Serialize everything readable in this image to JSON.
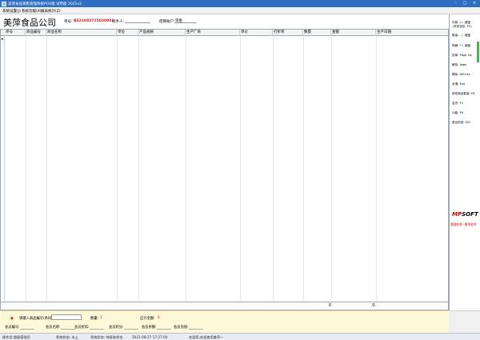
{
  "window": {
    "title": "美萍食品销售管理系统POS版 试用版 2021v2",
    "minimize_glyph": "–",
    "maximize_glyph": "□",
    "close_glyph": "×"
  },
  "menu": [
    "系统设置(J)",
    "系统功能(X)",
    "报表统计(Z)"
  ],
  "header": {
    "company": "美萍食品公司",
    "order_no_label": "单号:",
    "order_no": "BS21082715030001",
    "handler_label": "经手人:",
    "handler_value": "",
    "account_label": "结算账户:",
    "account_value": "现金"
  },
  "table": {
    "columns": [
      "序号",
      "商品编号",
      "商品名称",
      "单位",
      "产品规格",
      "生产厂商",
      "单价",
      "打折率",
      "数量",
      "金额",
      "生产日期"
    ],
    "row_marker": "▸",
    "rows": [],
    "total_qty": "0",
    "total_amount": "0."
  },
  "shortcuts": [
    {
      "key": "付款:",
      "value": "+/-键盘"
    },
    {
      "key": "",
      "value": "(系统设定 F5)"
    },
    {
      "key": "数量:",
      "value": "-/-键盘"
    },
    {
      "key": "明细:",
      "value": "*/-键盘"
    },
    {
      "key": "挂单:",
      "value": "Page Up"
    },
    {
      "key": "解挂:",
      "value": "Home"
    },
    {
      "key": "删除:",
      "value": "Delete"
    },
    {
      "key": "全清:",
      "value": "End"
    },
    {
      "key": "修改商品数量:",
      "value": "F8"
    },
    {
      "key": "会员:",
      "value": "F2"
    },
    {
      "key": "功能:",
      "value": "F6"
    },
    {
      "key": "退出系统:",
      "value": "ESC"
    }
  ],
  "brand": {
    "logo_part1": "MP",
    "logo_part2": "SOFT",
    "tech_support": "管理软件: 美萍软件"
  },
  "bottom": {
    "star": "◆",
    "code_label": "请输入商品编号(条码):",
    "code_value": "",
    "qty_label": "数量:",
    "qty_value": "1",
    "total_label": "应计金额:",
    "total_value": "0",
    "member_no_label": "会员编号:",
    "member_name_label": "会员名称:",
    "member_discount_label": "会员折扣:",
    "member_points_label": "会员积分:",
    "member_balance_label": "会员余额:",
    "member_pay_label": "会员充值:"
  },
  "status": {
    "user": "操作员:超级管理员",
    "state": "系统状态: 未上",
    "mode": "系统状态: 待接收状态",
    "datetime": "2021-08-27 17:27:04",
    "welcome": "欢迎您,欢迎使用美萍一"
  }
}
